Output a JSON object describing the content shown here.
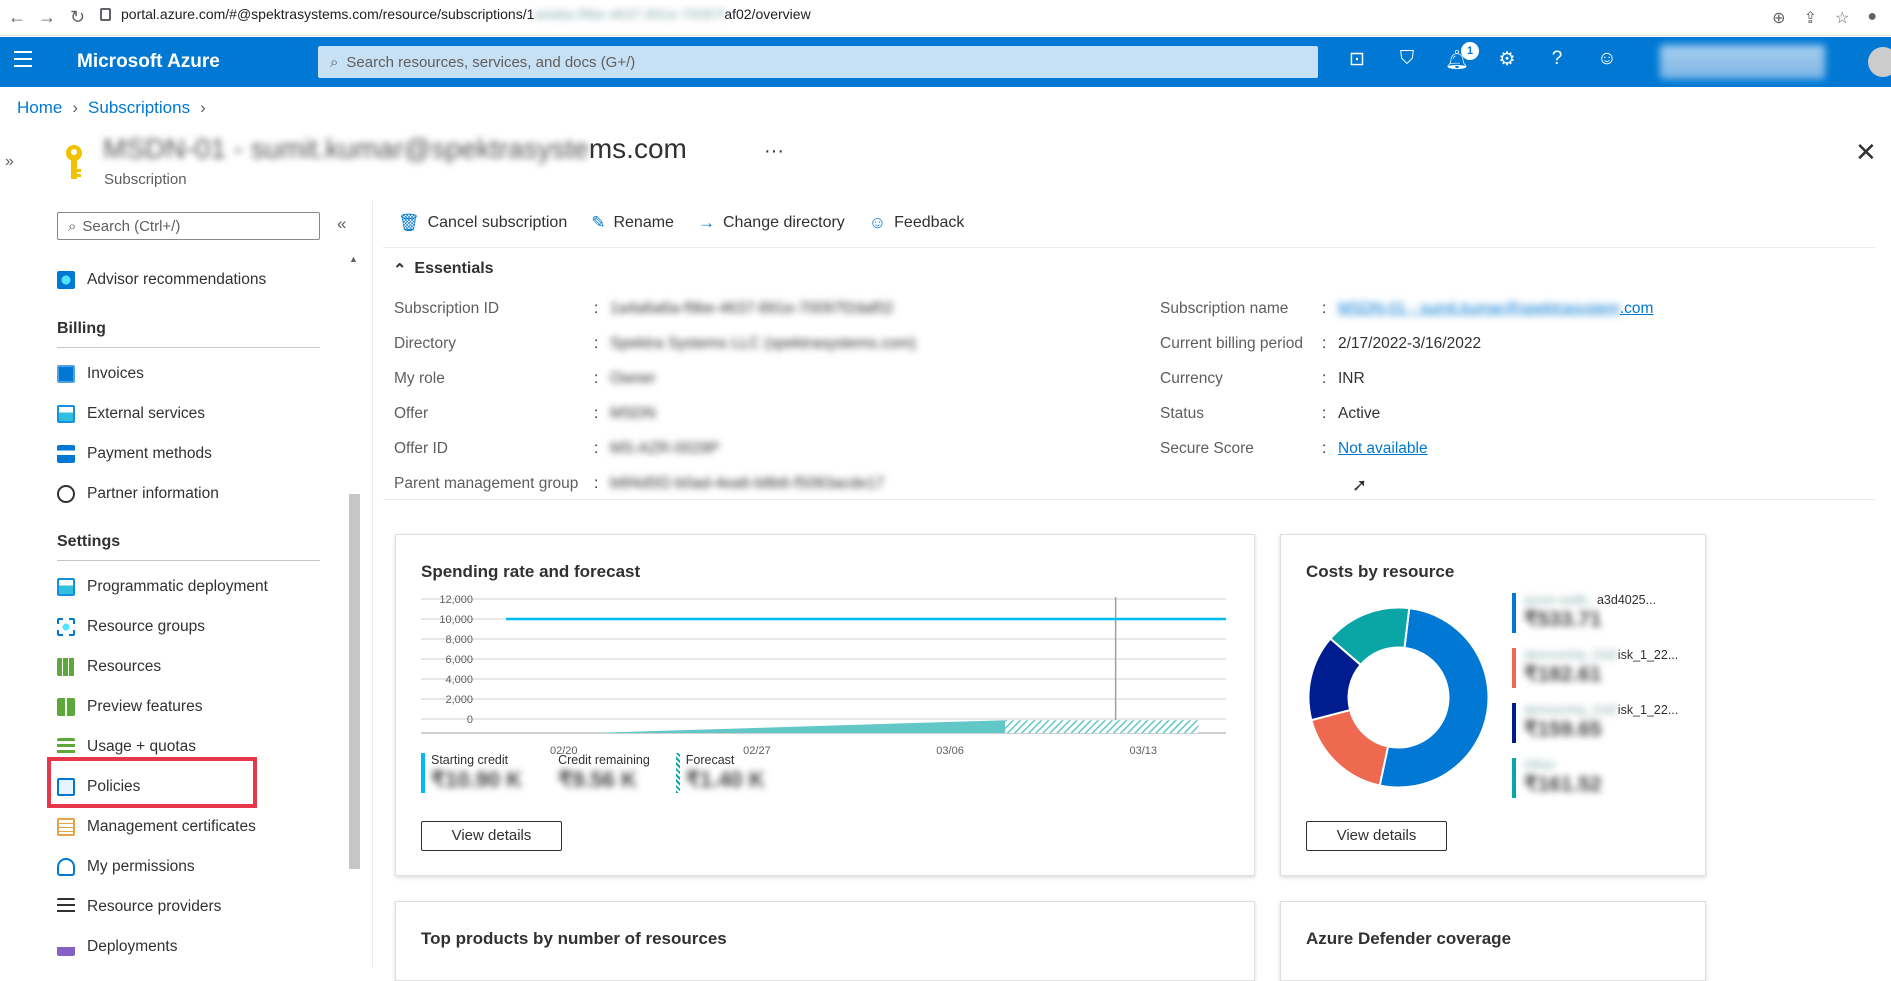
{
  "browser": {
    "url_prefix": "portal.azure.com/#@spektrasystems.com/resource/subscriptions/1",
    "url_hidden": "a4a6a-f9be-4637-891e-70097f",
    "url_suffix": "af02/overview"
  },
  "topbar": {
    "brand": "Microsoft Azure",
    "search_placeholder": "Search resources, services, and docs (G+/)",
    "notification_count": "1",
    "accent": "#0078d4"
  },
  "breadcrumb": {
    "home": "Home",
    "subscriptions": "Subscriptions"
  },
  "page": {
    "title_hidden": "MSDN-01 - sumit.kumar@spektrasyste",
    "title_suffix": "ms.com",
    "subtitle": "Subscription",
    "more": "···"
  },
  "leftnav": {
    "search_placeholder": "Search (Ctrl+/)",
    "items": [
      {
        "label": "Advisor recommendations",
        "icon": "advisor-icon"
      },
      {
        "label": "Billing",
        "section": true
      },
      {
        "label": "Invoices",
        "icon": "invoice-icon"
      },
      {
        "label": "External services",
        "icon": "external-services-icon"
      },
      {
        "label": "Payment methods",
        "icon": "payment-icon"
      },
      {
        "label": "Partner information",
        "icon": "partner-icon"
      },
      {
        "label": "Settings",
        "section": true
      },
      {
        "label": "Programmatic deployment",
        "icon": "deployment-icon"
      },
      {
        "label": "Resource groups",
        "icon": "resource-group-icon"
      },
      {
        "label": "Resources",
        "icon": "resources-grid-icon"
      },
      {
        "label": "Preview features",
        "icon": "preview-icon"
      },
      {
        "label": "Usage + quotas",
        "icon": "usage-icon"
      },
      {
        "label": "Policies",
        "icon": "policy-icon"
      },
      {
        "label": "Management certificates",
        "icon": "certificate-icon"
      },
      {
        "label": "My permissions",
        "icon": "person-icon"
      },
      {
        "label": "Resource providers",
        "icon": "providers-icon"
      },
      {
        "label": "Deployments",
        "icon": "deployments-icon"
      }
    ]
  },
  "commands": {
    "cancel": "Cancel subscription",
    "rename": "Rename",
    "change_directory": "Change directory",
    "feedback": "Feedback"
  },
  "essentials": {
    "header": "Essentials",
    "left": [
      {
        "key": "Subscription ID",
        "value": "1a4a6a6a-f9be-4637-891e-70097f2daf02"
      },
      {
        "key": "Directory",
        "value": "Spektra Systems LLC (spektrasystems.com)"
      },
      {
        "key": "My role",
        "value": "Owner"
      },
      {
        "key": "Offer",
        "value": "MSDN"
      },
      {
        "key": "Offer ID",
        "value": "MS-AZR-0029P"
      },
      {
        "key": "Parent management group",
        "value": "b6f4d5f2-b0ad-4ea6-b8b6-f5083acde17"
      }
    ],
    "right": [
      {
        "key": "Subscription name",
        "value_hidden": "MSDN-01 - sumit.kumar@spektrasystem",
        "value_suffix": ".com"
      },
      {
        "key": "Current billing period",
        "value": "2/17/2022-3/16/2022"
      },
      {
        "key": "Currency",
        "value": "INR"
      },
      {
        "key": "Status",
        "value": "Active"
      },
      {
        "key": "Secure Score",
        "value": "Not available"
      }
    ]
  },
  "spending_card": {
    "title": "Spending rate and forecast",
    "legend": [
      {
        "label": "Starting credit",
        "value": "₹10.90 K",
        "color": "#00bcf2"
      },
      {
        "label": "Credit remaining",
        "value": "₹9.56 K",
        "color": "#ffffff"
      },
      {
        "label": "Forecast",
        "value": "₹1.40 K",
        "color": "#62c7c7"
      }
    ],
    "button": "View details"
  },
  "chart_data": [
    {
      "type": "area",
      "title": "Spending rate and forecast",
      "y_ticks": [
        "12,000",
        "10,000",
        "8,000",
        "6,000",
        "4,000",
        "2,000",
        "0"
      ],
      "ylim": [
        0,
        12000
      ],
      "x_ticks": [
        "02/20",
        "02/27",
        "03/06",
        "03/13"
      ],
      "xlim": [
        "02/17",
        "03/16"
      ],
      "series": [
        {
          "name": "Starting credit",
          "points": [
            [
              "02/17",
              10000
            ],
            [
              "03/16",
              10000
            ]
          ]
        },
        {
          "points": [
            [
              "02/21",
              0
            ],
            [
              "03/08",
              800
            ]
          ]
        },
        {
          "name": "Forecast",
          "points": [
            [
              "03/08",
              800
            ],
            [
              "03/15",
              800
            ]
          ]
        }
      ],
      "today": "03/12",
      "grid": true
    },
    {
      "type": "pie",
      "title": "Costs by resource",
      "slices": [
        {
          "label": "azure-sadb...a3d4025...",
          "value": 533.71,
          "color": "#0078d4"
        },
        {
          "label": "demovmhp...disk_1_22...",
          "value": 182.61,
          "color": "#ef6950"
        },
        {
          "label": "demovmhp...disk_1_22...",
          "value": 159.65,
          "color": "#001d8f"
        },
        {
          "label": "Other",
          "value": 161.52,
          "color": "#0aa6a6"
        }
      ]
    }
  ],
  "costs_card": {
    "title": "Costs by resource",
    "legend": [
      {
        "name": "azure-sadb...a3d4025...",
        "name_hidden": "azure-sadb...",
        "name_visible": "a3d4025...",
        "amount": "₹533.71",
        "color": "#0078d4"
      },
      {
        "name_hidden": "demovmhp_OsD",
        "name_visible": "isk_1_22...",
        "amount": "₹182.61",
        "color": "#ef6950"
      },
      {
        "name_hidden": "demovmhp_OsD",
        "name_visible": "isk_1_22...",
        "amount": "₹159.65",
        "color": "#001d8f"
      },
      {
        "name_hidden": "Other",
        "name_visible": "",
        "amount": "₹161.52",
        "color": "#0aa6a6"
      }
    ],
    "button": "View details"
  },
  "bottom_cards": {
    "top_products": "Top products by number of resources",
    "defender": "Azure Defender coverage"
  }
}
